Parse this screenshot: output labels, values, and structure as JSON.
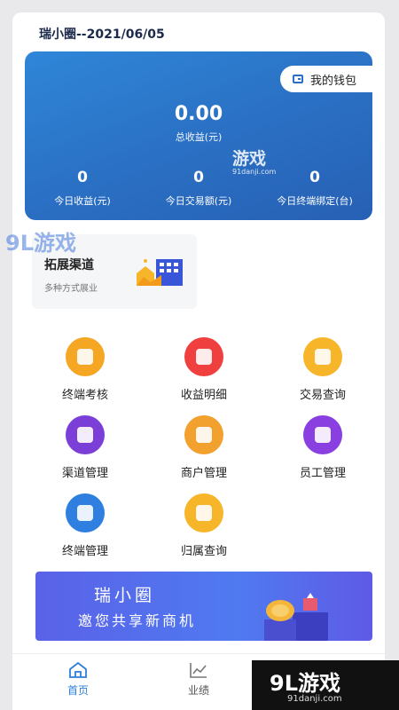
{
  "header": {
    "title": "瑞小圈--2021/06/05"
  },
  "earnings_card": {
    "wallet_label": "我的钱包",
    "total_value": "0.00",
    "total_label": "总收益(元)",
    "stats": [
      {
        "value": "0",
        "label": "今日收益(元)"
      },
      {
        "value": "0",
        "label": "今日交易额(元)"
      },
      {
        "value": "0",
        "label": "今日终端绑定(台)"
      }
    ]
  },
  "expand_channel": {
    "title": "拓展渠道",
    "subtitle": "多种方式展业"
  },
  "menu": [
    {
      "label": "终端考核",
      "icon": "calculator-icon",
      "color": "#f5a623"
    },
    {
      "label": "收益明细",
      "icon": "wallet-icon",
      "color": "#ef3f3f"
    },
    {
      "label": "交易查询",
      "icon": "search-icon",
      "color": "#f7b62a"
    },
    {
      "label": "渠道管理",
      "icon": "storage-icon",
      "color": "#7b3fd8"
    },
    {
      "label": "商户管理",
      "icon": "merchant-icon",
      "color": "#f3a12e"
    },
    {
      "label": "员工管理",
      "icon": "user-icon",
      "color": "#8a3fe0"
    },
    {
      "label": "终端管理",
      "icon": "document-icon",
      "color": "#2f7fe0"
    },
    {
      "label": "归属查询",
      "icon": "chart-search-icon",
      "color": "#f7b62a"
    }
  ],
  "banner": {
    "line1": "瑞小圈",
    "line2": "邀您共享新商机"
  },
  "tabbar": [
    {
      "label": "首页",
      "icon": "home-icon",
      "active": true
    },
    {
      "label": "业绩",
      "icon": "line-chart-icon",
      "active": false
    }
  ],
  "watermarks": {
    "small": "游戏",
    "small_url": "91danji.com",
    "big": "9L游戏",
    "corner": "9L游戏",
    "corner_url": "91danji.com"
  },
  "colors": {
    "accent": "#2f7fd8",
    "card_gradient_start": "#2f86d8",
    "card_gradient_end": "#2760b4",
    "banner": "#5a62e8"
  }
}
